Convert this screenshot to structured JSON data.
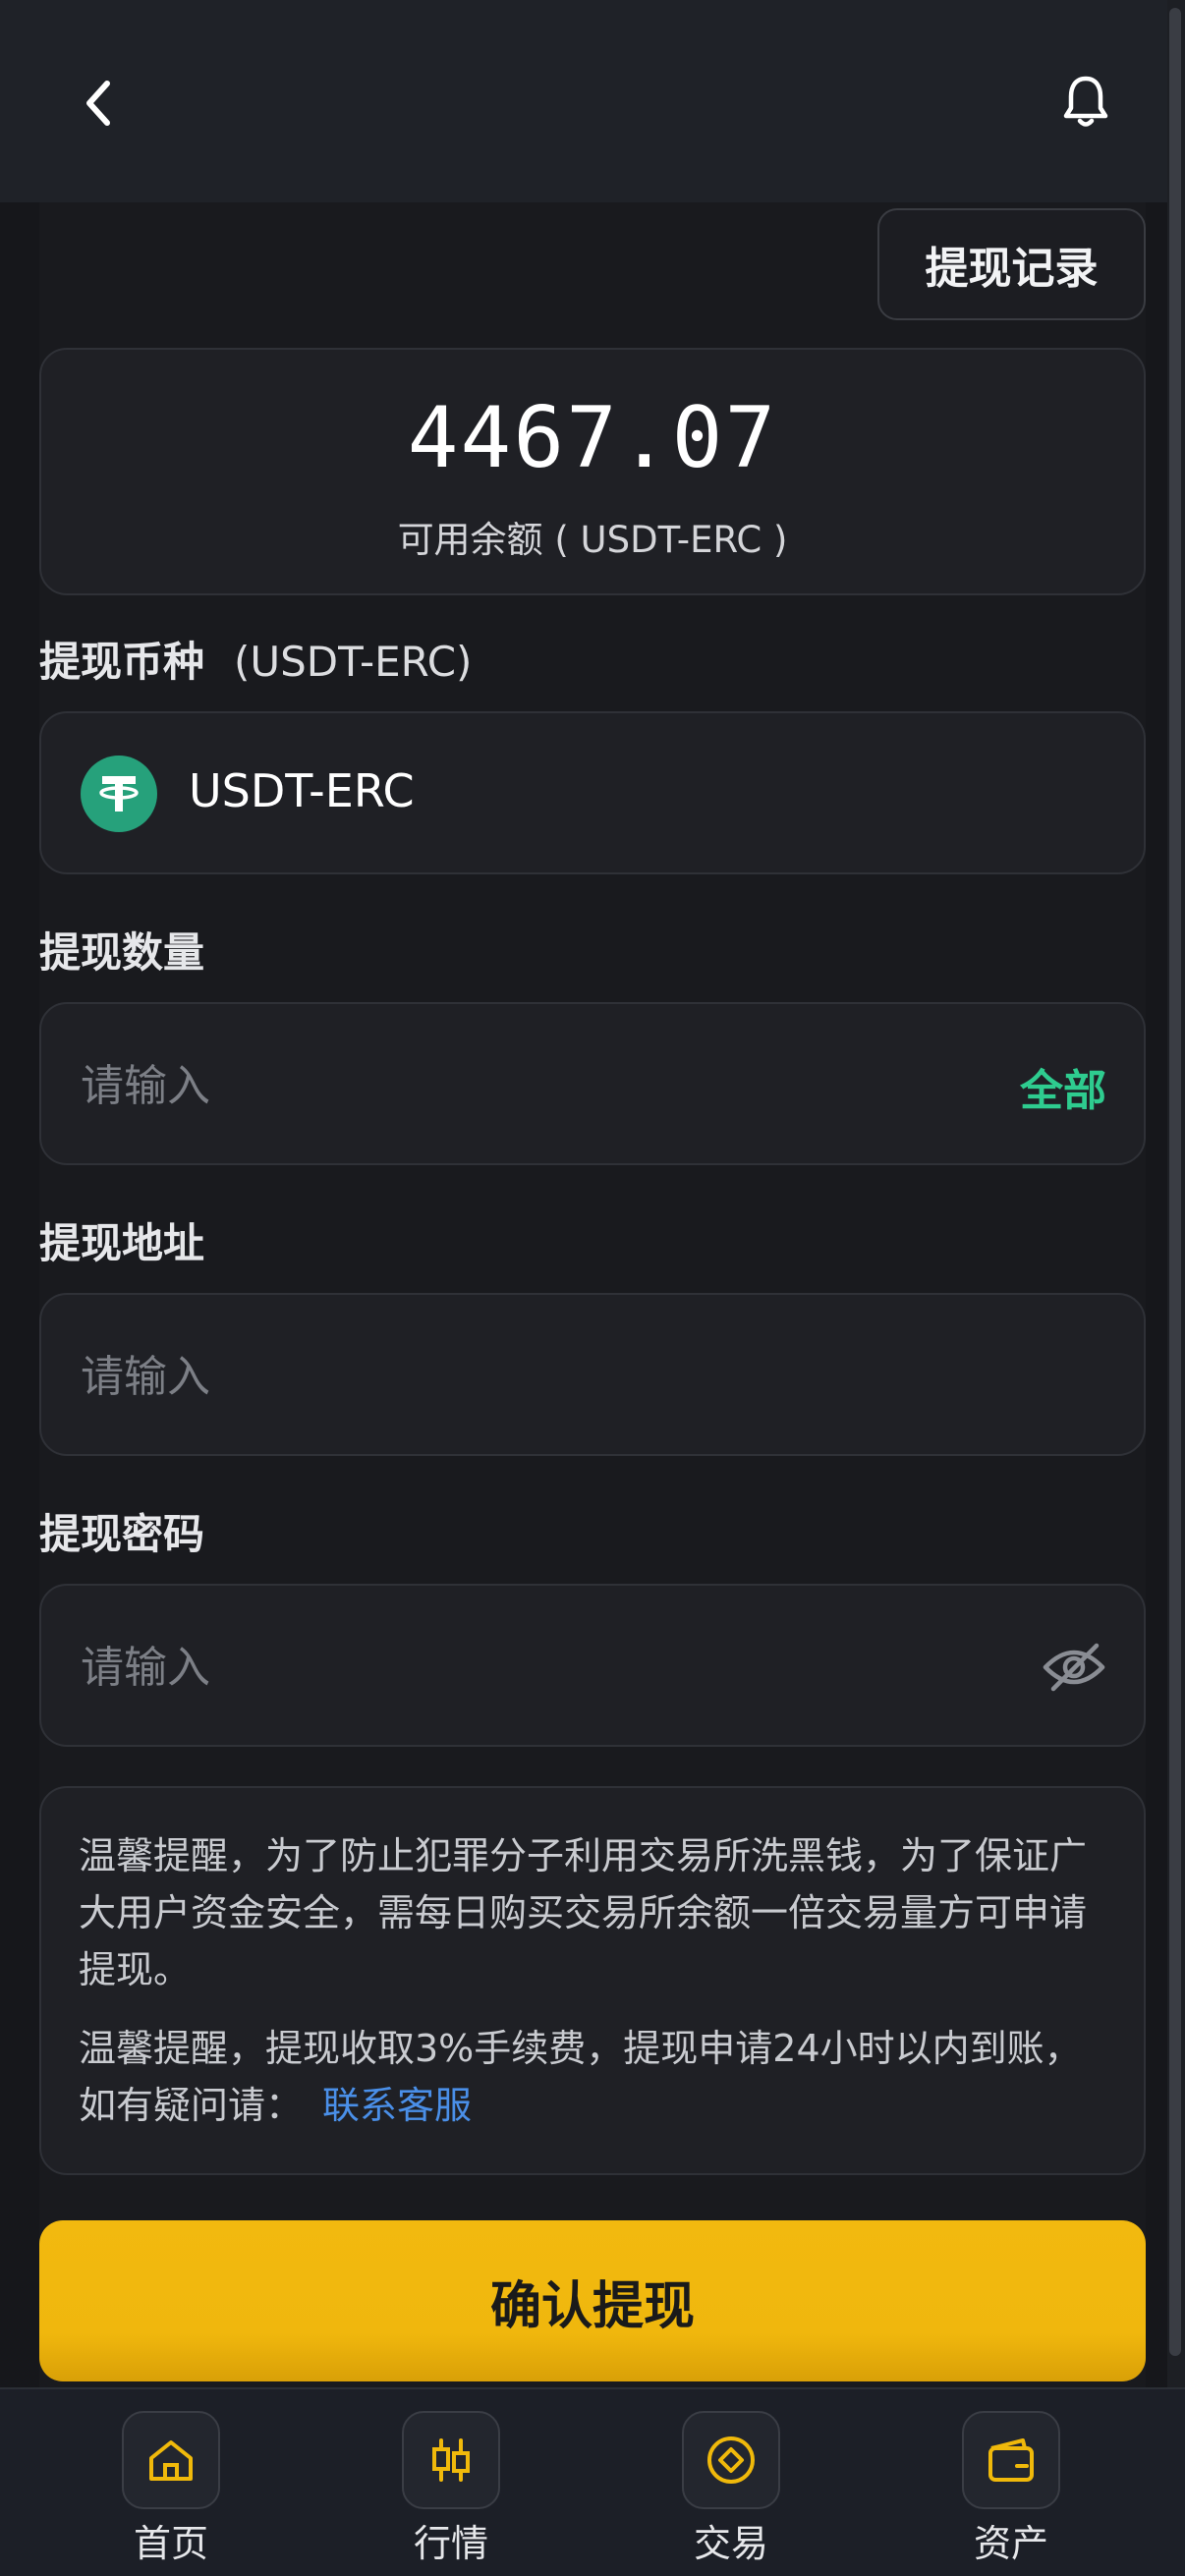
{
  "header": {
    "history_button": "提现记录"
  },
  "balance": {
    "amount": "4467.07",
    "caption": "可用余额 ( USDT-ERC )"
  },
  "currency_section": {
    "label": "提现币种",
    "suffix": "(USDT-ERC)",
    "selected_coin": "USDT-ERC",
    "coin_icon": "tether-icon"
  },
  "amount_section": {
    "label": "提现数量",
    "placeholder": "请输入",
    "all_button": "全部"
  },
  "address_section": {
    "label": "提现地址",
    "placeholder": "请输入"
  },
  "password_section": {
    "label": "提现密码",
    "placeholder": "请输入"
  },
  "notice": {
    "line1": "温馨提醒，为了防止犯罪分子利用交易所洗黑钱，为了保证广大用户资金安全，需每日购买交易所余额一倍交易量方可申请提现。",
    "line2": "温馨提醒，提现收取3%手续费，提现申请24小时以内到账，如有疑问请：",
    "contact_link": "联系客服"
  },
  "confirm_button": "确认提现",
  "bottom_nav": [
    {
      "label": "首页",
      "icon": "home-icon"
    },
    {
      "label": "行情",
      "icon": "chart-icon"
    },
    {
      "label": "交易",
      "icon": "trade-icon"
    },
    {
      "label": "资产",
      "icon": "wallet-icon"
    }
  ],
  "colors": {
    "accent_yellow": "#f0b90b",
    "accent_green": "#2ecc8f",
    "link_blue": "#4a8fe8",
    "tether_green": "#26a17b"
  }
}
